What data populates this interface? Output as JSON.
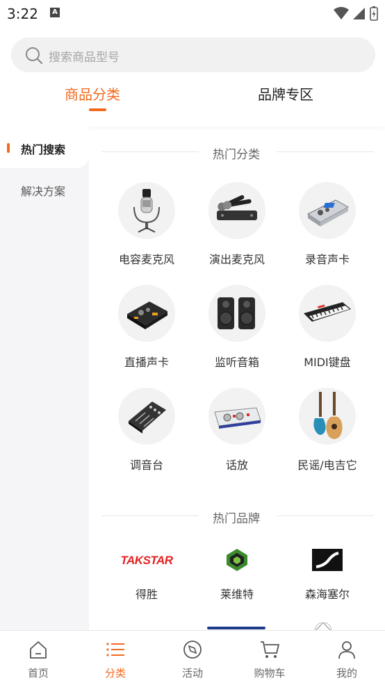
{
  "status_bar": {
    "time": "3:22",
    "notification_icon": "a-icon"
  },
  "search": {
    "placeholder": "搜索商品型号"
  },
  "tabs": [
    {
      "label": "商品分类",
      "active": true
    },
    {
      "label": "品牌专区",
      "active": false
    }
  ],
  "sidebar": {
    "items": [
      {
        "label": "热门搜索",
        "active": true
      },
      {
        "label": "解决方案",
        "active": false
      }
    ]
  },
  "sections": {
    "hot_categories": "热门分类",
    "hot_brands": "热门品牌"
  },
  "categories": [
    {
      "label": "电容麦克风",
      "icon": "condenser-mic-icon"
    },
    {
      "label": "演出麦克风",
      "icon": "wireless-mic-icon"
    },
    {
      "label": "录音声卡",
      "icon": "audio-interface-icon"
    },
    {
      "label": "直播声卡",
      "icon": "live-soundcard-icon"
    },
    {
      "label": "监听音箱",
      "icon": "monitor-speaker-icon"
    },
    {
      "label": "MIDI键盘",
      "icon": "midi-keyboard-icon"
    },
    {
      "label": "调音台",
      "icon": "mixer-icon"
    },
    {
      "label": "话放",
      "icon": "preamp-icon"
    },
    {
      "label": "民谣/电吉它",
      "icon": "guitar-icon"
    }
  ],
  "brands": [
    {
      "label": "得胜",
      "logo_text": "TAKSTAR",
      "logo_color": "#e32222"
    },
    {
      "label": "莱维特",
      "logo_text": "",
      "logo_color": "#3b8a2e"
    },
    {
      "label": "森海塞尔",
      "logo_text": "",
      "logo_color": "#111111"
    }
  ],
  "bottom_nav": [
    {
      "label": "首页",
      "icon": "home-icon",
      "active": false
    },
    {
      "label": "分类",
      "icon": "list-icon",
      "active": true
    },
    {
      "label": "活动",
      "icon": "compass-icon",
      "active": false
    },
    {
      "label": "购物车",
      "icon": "cart-icon",
      "active": false
    },
    {
      "label": "我的",
      "icon": "user-icon",
      "active": false
    }
  ],
  "colors": {
    "accent": "#f06a1e"
  }
}
